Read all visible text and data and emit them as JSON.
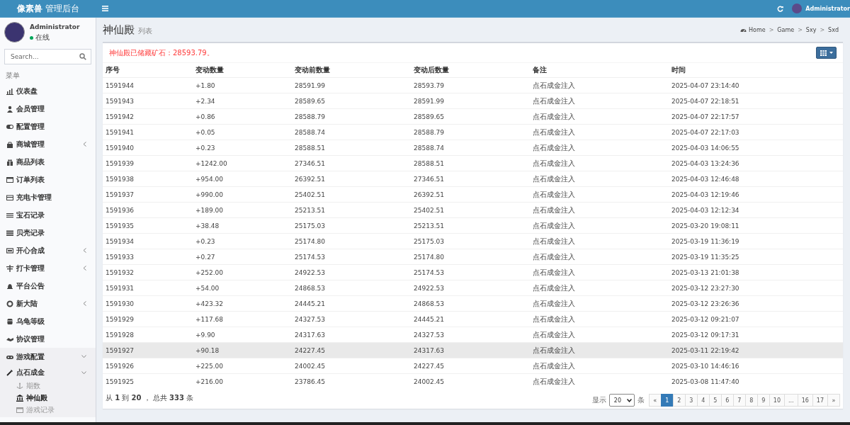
{
  "header": {
    "logo_bold": "像素兽",
    "logo_rest": "管理后台",
    "user": "Administrator"
  },
  "sidebar": {
    "user": {
      "name": "Administrator",
      "status": "在线",
      "online": true
    },
    "search": {
      "placeholder": "Search..."
    },
    "section": "菜单",
    "items": [
      {
        "label": "仪表盘"
      },
      {
        "label": "会员管理"
      },
      {
        "label": "配置管理"
      },
      {
        "label": "商城管理",
        "expanded": false
      },
      {
        "label": "商品列表"
      },
      {
        "label": "订单列表"
      },
      {
        "label": "充电卡管理"
      },
      {
        "label": "宝石记录"
      },
      {
        "label": "贝壳记录"
      },
      {
        "label": "开心合成",
        "expanded": false
      },
      {
        "label": "打卡管理",
        "expanded": false
      },
      {
        "label": "平台公告"
      },
      {
        "label": "新大陆",
        "expanded": false
      },
      {
        "label": "乌龟等级"
      },
      {
        "label": "协议管理"
      },
      {
        "label": "游戏配置",
        "expanded": true,
        "children": [
          {
            "label": "点石成金",
            "expanded": true,
            "children": [
              {
                "label": "期数",
                "selected": false
              },
              {
                "label": "神仙殿",
                "selected": true
              },
              {
                "label": "游戏记录",
                "selected": false
              }
            ]
          }
        ]
      }
    ]
  },
  "page": {
    "title": "神仙殿",
    "subtitle": "列表",
    "breadcrumb": [
      "Home",
      "Game",
      "Sxy",
      "Sxd"
    ],
    "breadcrumb_separator": ">"
  },
  "notice": "神仙殿已储藏矿石：28593.79。",
  "table": {
    "columns": [
      "序号",
      "变动数量",
      "变动前数量",
      "变动后数量",
      "备注",
      "时间"
    ],
    "rows": [
      {
        "cells": [
          "1591944",
          "+1.80",
          "28591.99",
          "28593.79",
          "点石成金注入",
          "2025-04-07 23:14:40"
        ],
        "hovered": false
      },
      {
        "cells": [
          "1591943",
          "+2.34",
          "28589.65",
          "28591.99",
          "点石成金注入",
          "2025-04-07 22:18:51"
        ],
        "hovered": false
      },
      {
        "cells": [
          "1591942",
          "+0.86",
          "28588.79",
          "28589.65",
          "点石成金注入",
          "2025-04-07 22:17:57"
        ],
        "hovered": false
      },
      {
        "cells": [
          "1591941",
          "+0.05",
          "28588.74",
          "28588.79",
          "点石成金注入",
          "2025-04-07 22:17:03"
        ],
        "hovered": false
      },
      {
        "cells": [
          "1591940",
          "+0.23",
          "28588.51",
          "28588.74",
          "点石成金注入",
          "2025-04-03 14:06:55"
        ],
        "hovered": false
      },
      {
        "cells": [
          "1591939",
          "+1242.00",
          "27346.51",
          "28588.51",
          "点石成金注入",
          "2025-04-03 13:24:36"
        ],
        "hovered": false
      },
      {
        "cells": [
          "1591938",
          "+954.00",
          "26392.51",
          "27346.51",
          "点石成金注入",
          "2025-04-03 12:46:48"
        ],
        "hovered": false
      },
      {
        "cells": [
          "1591937",
          "+990.00",
          "25402.51",
          "26392.51",
          "点石成金注入",
          "2025-04-03 12:19:46"
        ],
        "hovered": false
      },
      {
        "cells": [
          "1591936",
          "+189.00",
          "25213.51",
          "25402.51",
          "点石成金注入",
          "2025-04-03 12:12:34"
        ],
        "hovered": false
      },
      {
        "cells": [
          "1591935",
          "+38.48",
          "25175.03",
          "25213.51",
          "点石成金注入",
          "2025-03-20 19:08:11"
        ],
        "hovered": false
      },
      {
        "cells": [
          "1591934",
          "+0.23",
          "25174.80",
          "25175.03",
          "点石成金注入",
          "2025-03-19 11:36:19"
        ],
        "hovered": false
      },
      {
        "cells": [
          "1591933",
          "+0.27",
          "25174.53",
          "25174.80",
          "点石成金注入",
          "2025-03-19 11:35:25"
        ],
        "hovered": false
      },
      {
        "cells": [
          "1591932",
          "+252.00",
          "24922.53",
          "25174.53",
          "点石成金注入",
          "2025-03-13 21:01:38"
        ],
        "hovered": false
      },
      {
        "cells": [
          "1591931",
          "+54.00",
          "24868.53",
          "24922.53",
          "点石成金注入",
          "2025-03-12 23:27:30"
        ],
        "hovered": false
      },
      {
        "cells": [
          "1591930",
          "+423.32",
          "24445.21",
          "24868.53",
          "点石成金注入",
          "2025-03-12 23:26:36"
        ],
        "hovered": false
      },
      {
        "cells": [
          "1591929",
          "+117.68",
          "24327.53",
          "24445.21",
          "点石成金注入",
          "2025-03-12 09:21:07"
        ],
        "hovered": false
      },
      {
        "cells": [
          "1591928",
          "+9.90",
          "24317.63",
          "24327.53",
          "点石成金注入",
          "2025-03-12 09:17:31"
        ],
        "hovered": false
      },
      {
        "cells": [
          "1591927",
          "+90.18",
          "24227.45",
          "24317.63",
          "点石成金注入",
          "2025-03-11 22:19:42"
        ],
        "hovered": true
      },
      {
        "cells": [
          "1591926",
          "+225.00",
          "24002.45",
          "24227.45",
          "点石成金注入",
          "2025-03-10 14:46:16"
        ],
        "hovered": false
      },
      {
        "cells": [
          "1591925",
          "+216.00",
          "23786.45",
          "24002.45",
          "点石成金注入",
          "2025-03-08 11:47:40"
        ],
        "hovered": false
      }
    ]
  },
  "footer": {
    "summary": "从 **1** 到 **20** ， 总共 **333** 条",
    "show_label": "显示",
    "page_size": "20",
    "unit": "条",
    "pages": [
      {
        "label": "«",
        "selected": false
      },
      {
        "label": "1",
        "selected": true
      },
      {
        "label": "2",
        "selected": false
      },
      {
        "label": "3",
        "selected": false
      },
      {
        "label": "4",
        "selected": false
      },
      {
        "label": "5",
        "selected": false
      },
      {
        "label": "6",
        "selected": false
      },
      {
        "label": "7",
        "selected": false
      },
      {
        "label": "8",
        "selected": false
      },
      {
        "label": "9",
        "selected": false
      },
      {
        "label": "10",
        "selected": false
      },
      {
        "label": "...",
        "selected": false
      },
      {
        "label": "16",
        "selected": false
      },
      {
        "label": "17",
        "selected": false
      },
      {
        "label": "»",
        "selected": false
      }
    ]
  }
}
